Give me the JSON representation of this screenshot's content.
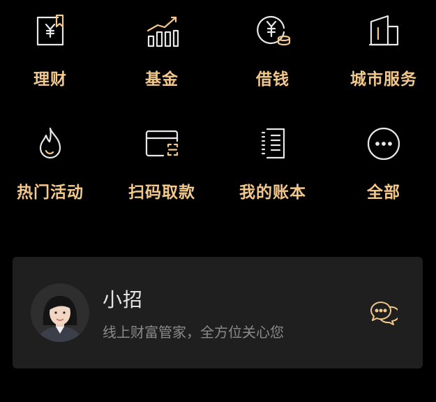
{
  "colors": {
    "background": "#000000",
    "label": "#f3c88b",
    "icon_stroke": "#e8e8e8",
    "icon_accent": "#f3c88b",
    "card_background": "#1f1f1f"
  },
  "services": {
    "row1": [
      {
        "label": "理财",
        "icon": "wealth-management-icon"
      },
      {
        "label": "基金",
        "icon": "fund-chart-icon"
      },
      {
        "label": "借钱",
        "icon": "borrow-money-icon"
      },
      {
        "label": "城市服务",
        "icon": "city-services-icon"
      }
    ],
    "row2": [
      {
        "label": "热门活动",
        "icon": "flame-icon"
      },
      {
        "label": "扫码取款",
        "icon": "scan-card-icon"
      },
      {
        "label": "我的账本",
        "icon": "ledger-icon"
      },
      {
        "label": "全部",
        "icon": "more-icon"
      }
    ]
  },
  "assistant": {
    "name": "小招",
    "description": "线上财富管家，全方位关心您",
    "avatar_icon": "assistant-avatar",
    "chat_icon": "chat-bubbles-icon"
  }
}
